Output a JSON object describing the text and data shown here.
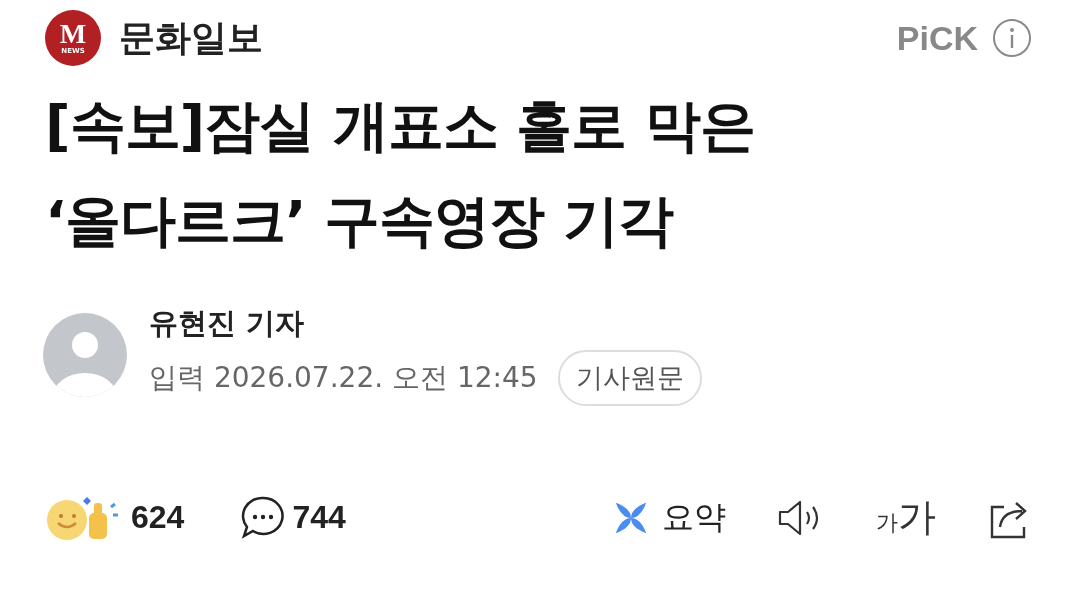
{
  "header": {
    "logo_letter": "M",
    "logo_sub": "NEWS",
    "publisher": "문화일보",
    "badge": "PiCK"
  },
  "headline": "[속보]잠실 개표소 홀로 막은 ‘올다르크’ 구속영장 기각",
  "byline": {
    "reporter": "유현진 기자",
    "published": "입력 2026.07.22. 오전 12:45",
    "original_button": "기사원문"
  },
  "actions": {
    "reactions": "624",
    "comments": "744",
    "summary": "요약",
    "font_small": "가",
    "font_large": "가"
  }
}
